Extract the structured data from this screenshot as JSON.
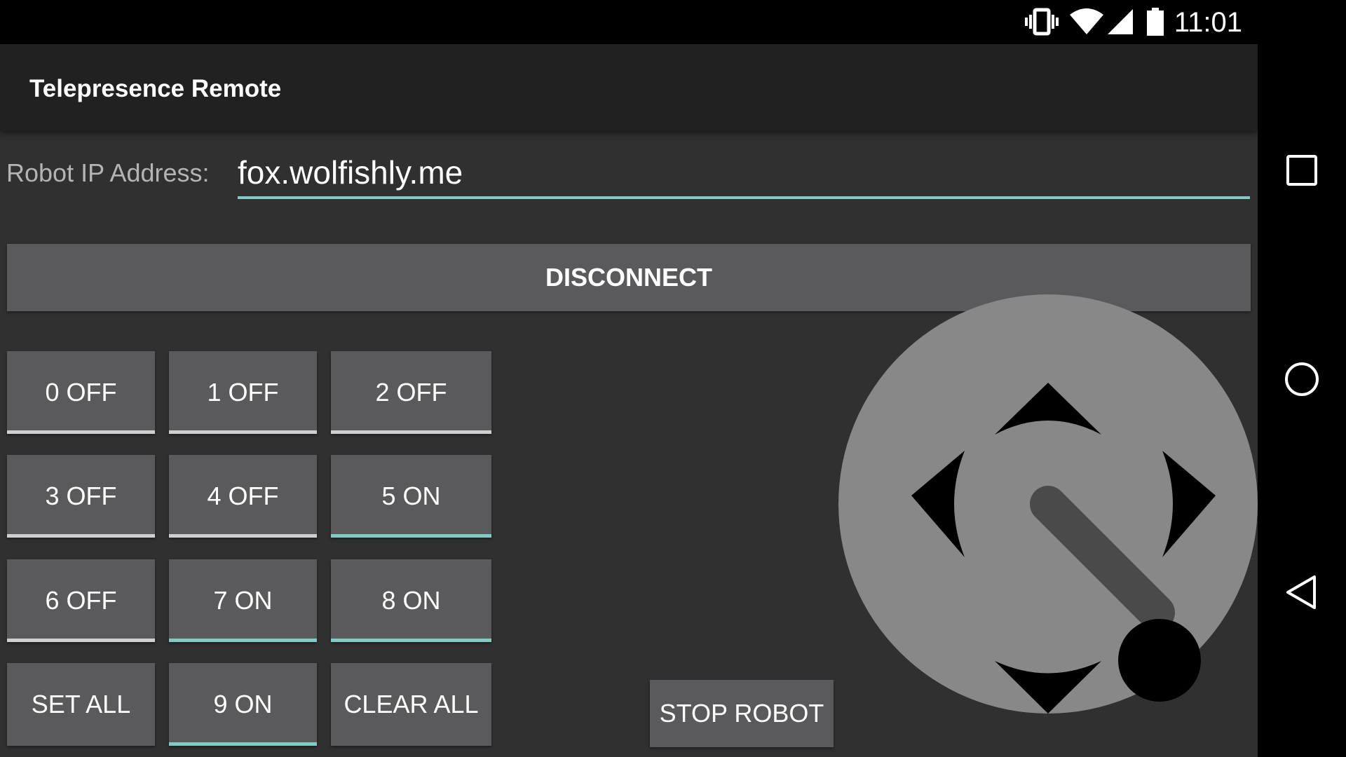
{
  "status_bar": {
    "time": "11:01",
    "icons": [
      "vibrate-icon",
      "wifi-icon",
      "cell-signal-icon",
      "battery-icon"
    ]
  },
  "app": {
    "title": "Telepresence Remote",
    "ip_label": "Robot IP Address:",
    "ip_value": "fox.wolfishly.me",
    "disconnect_label": "DISCONNECT",
    "toggles": [
      {
        "label": "0 OFF",
        "on": false
      },
      {
        "label": "1 OFF",
        "on": false
      },
      {
        "label": "2 OFF",
        "on": false
      },
      {
        "label": "3 OFF",
        "on": false
      },
      {
        "label": "4 OFF",
        "on": false
      },
      {
        "label": "5 ON",
        "on": true
      },
      {
        "label": "6 OFF",
        "on": false
      },
      {
        "label": "7 ON",
        "on": true
      },
      {
        "label": "8 ON",
        "on": true
      },
      {
        "label": "SET ALL",
        "on": false
      },
      {
        "label": "9 ON",
        "on": true
      },
      {
        "label": "CLEAR ALL",
        "on": false
      }
    ],
    "stop_label": "STOP ROBOT"
  },
  "nav_bar": {
    "icons": [
      "recents-icon",
      "home-icon",
      "back-icon"
    ]
  },
  "colors": {
    "accent": "#80cbc4",
    "background": "#303030",
    "actionbar": "#212121",
    "button": "#5a5a5c",
    "joystick": "#888888"
  }
}
